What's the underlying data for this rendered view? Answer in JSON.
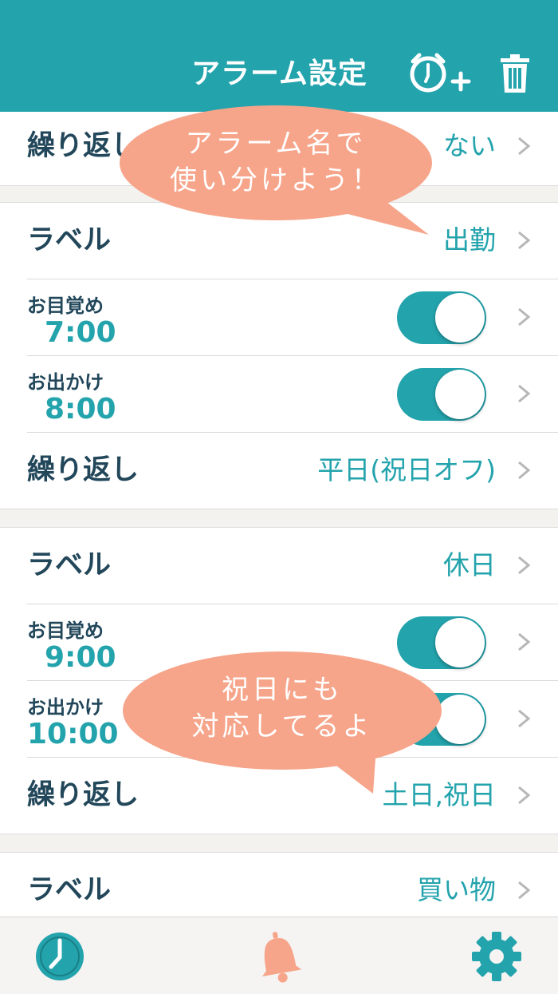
{
  "header": {
    "title": "アラーム設定"
  },
  "icons": {
    "add_alarm": "alarm-add-icon",
    "delete": "trash-icon",
    "clock_tab": "clock-icon",
    "bell_tab": "bell-icon",
    "settings_tab": "gear-icon",
    "chevron": "chevron-right-icon"
  },
  "colors": {
    "accent": "#23a3ac",
    "bubble": "#f6a58a",
    "label": "#22475a",
    "background": "#f3f2ef"
  },
  "partial_group": {
    "repeat_label": "繰り返し",
    "repeat_value": "ない"
  },
  "groups": [
    {
      "label_title": "ラベル",
      "label_value": "出勤",
      "alarms": [
        {
          "name": "お目覚め",
          "time": "7:00",
          "enabled": true
        },
        {
          "name": "お出かけ",
          "time": "8:00",
          "enabled": true
        }
      ],
      "repeat_label": "繰り返し",
      "repeat_value": "平日(祝日オフ)"
    },
    {
      "label_title": "ラベル",
      "label_value": "休日",
      "alarms": [
        {
          "name": "お目覚め",
          "time": "9:00",
          "enabled": true
        },
        {
          "name": "お出かけ",
          "time": "10:00",
          "enabled": true
        }
      ],
      "repeat_label": "繰り返し",
      "repeat_value": "土日,祝日"
    },
    {
      "label_title": "ラベル",
      "label_value": "買い物"
    }
  ],
  "callouts": [
    {
      "line1": "アラーム名で",
      "line2": "使い分けよう！"
    },
    {
      "line1": "祝日にも",
      "line2": "対応してるよ"
    }
  ]
}
